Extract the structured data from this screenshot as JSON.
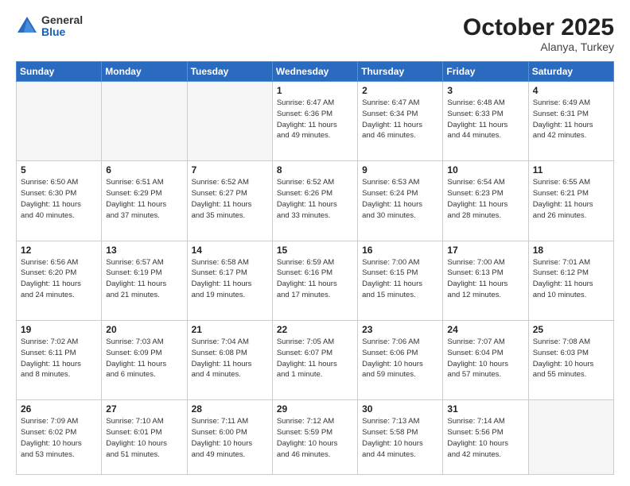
{
  "header": {
    "logo": {
      "general": "General",
      "blue": "Blue"
    },
    "month": "October 2025",
    "location": "Alanya, Turkey"
  },
  "weekdays": [
    "Sunday",
    "Monday",
    "Tuesday",
    "Wednesday",
    "Thursday",
    "Friday",
    "Saturday"
  ],
  "weeks": [
    [
      {
        "day": "",
        "info": ""
      },
      {
        "day": "",
        "info": ""
      },
      {
        "day": "",
        "info": ""
      },
      {
        "day": "1",
        "info": "Sunrise: 6:47 AM\nSunset: 6:36 PM\nDaylight: 11 hours\nand 49 minutes."
      },
      {
        "day": "2",
        "info": "Sunrise: 6:47 AM\nSunset: 6:34 PM\nDaylight: 11 hours\nand 46 minutes."
      },
      {
        "day": "3",
        "info": "Sunrise: 6:48 AM\nSunset: 6:33 PM\nDaylight: 11 hours\nand 44 minutes."
      },
      {
        "day": "4",
        "info": "Sunrise: 6:49 AM\nSunset: 6:31 PM\nDaylight: 11 hours\nand 42 minutes."
      }
    ],
    [
      {
        "day": "5",
        "info": "Sunrise: 6:50 AM\nSunset: 6:30 PM\nDaylight: 11 hours\nand 40 minutes."
      },
      {
        "day": "6",
        "info": "Sunrise: 6:51 AM\nSunset: 6:29 PM\nDaylight: 11 hours\nand 37 minutes."
      },
      {
        "day": "7",
        "info": "Sunrise: 6:52 AM\nSunset: 6:27 PM\nDaylight: 11 hours\nand 35 minutes."
      },
      {
        "day": "8",
        "info": "Sunrise: 6:52 AM\nSunset: 6:26 PM\nDaylight: 11 hours\nand 33 minutes."
      },
      {
        "day": "9",
        "info": "Sunrise: 6:53 AM\nSunset: 6:24 PM\nDaylight: 11 hours\nand 30 minutes."
      },
      {
        "day": "10",
        "info": "Sunrise: 6:54 AM\nSunset: 6:23 PM\nDaylight: 11 hours\nand 28 minutes."
      },
      {
        "day": "11",
        "info": "Sunrise: 6:55 AM\nSunset: 6:21 PM\nDaylight: 11 hours\nand 26 minutes."
      }
    ],
    [
      {
        "day": "12",
        "info": "Sunrise: 6:56 AM\nSunset: 6:20 PM\nDaylight: 11 hours\nand 24 minutes."
      },
      {
        "day": "13",
        "info": "Sunrise: 6:57 AM\nSunset: 6:19 PM\nDaylight: 11 hours\nand 21 minutes."
      },
      {
        "day": "14",
        "info": "Sunrise: 6:58 AM\nSunset: 6:17 PM\nDaylight: 11 hours\nand 19 minutes."
      },
      {
        "day": "15",
        "info": "Sunrise: 6:59 AM\nSunset: 6:16 PM\nDaylight: 11 hours\nand 17 minutes."
      },
      {
        "day": "16",
        "info": "Sunrise: 7:00 AM\nSunset: 6:15 PM\nDaylight: 11 hours\nand 15 minutes."
      },
      {
        "day": "17",
        "info": "Sunrise: 7:00 AM\nSunset: 6:13 PM\nDaylight: 11 hours\nand 12 minutes."
      },
      {
        "day": "18",
        "info": "Sunrise: 7:01 AM\nSunset: 6:12 PM\nDaylight: 11 hours\nand 10 minutes."
      }
    ],
    [
      {
        "day": "19",
        "info": "Sunrise: 7:02 AM\nSunset: 6:11 PM\nDaylight: 11 hours\nand 8 minutes."
      },
      {
        "day": "20",
        "info": "Sunrise: 7:03 AM\nSunset: 6:09 PM\nDaylight: 11 hours\nand 6 minutes."
      },
      {
        "day": "21",
        "info": "Sunrise: 7:04 AM\nSunset: 6:08 PM\nDaylight: 11 hours\nand 4 minutes."
      },
      {
        "day": "22",
        "info": "Sunrise: 7:05 AM\nSunset: 6:07 PM\nDaylight: 11 hours\nand 1 minute."
      },
      {
        "day": "23",
        "info": "Sunrise: 7:06 AM\nSunset: 6:06 PM\nDaylight: 10 hours\nand 59 minutes."
      },
      {
        "day": "24",
        "info": "Sunrise: 7:07 AM\nSunset: 6:04 PM\nDaylight: 10 hours\nand 57 minutes."
      },
      {
        "day": "25",
        "info": "Sunrise: 7:08 AM\nSunset: 6:03 PM\nDaylight: 10 hours\nand 55 minutes."
      }
    ],
    [
      {
        "day": "26",
        "info": "Sunrise: 7:09 AM\nSunset: 6:02 PM\nDaylight: 10 hours\nand 53 minutes."
      },
      {
        "day": "27",
        "info": "Sunrise: 7:10 AM\nSunset: 6:01 PM\nDaylight: 10 hours\nand 51 minutes."
      },
      {
        "day": "28",
        "info": "Sunrise: 7:11 AM\nSunset: 6:00 PM\nDaylight: 10 hours\nand 49 minutes."
      },
      {
        "day": "29",
        "info": "Sunrise: 7:12 AM\nSunset: 5:59 PM\nDaylight: 10 hours\nand 46 minutes."
      },
      {
        "day": "30",
        "info": "Sunrise: 7:13 AM\nSunset: 5:58 PM\nDaylight: 10 hours\nand 44 minutes."
      },
      {
        "day": "31",
        "info": "Sunrise: 7:14 AM\nSunset: 5:56 PM\nDaylight: 10 hours\nand 42 minutes."
      },
      {
        "day": "",
        "info": ""
      }
    ]
  ]
}
